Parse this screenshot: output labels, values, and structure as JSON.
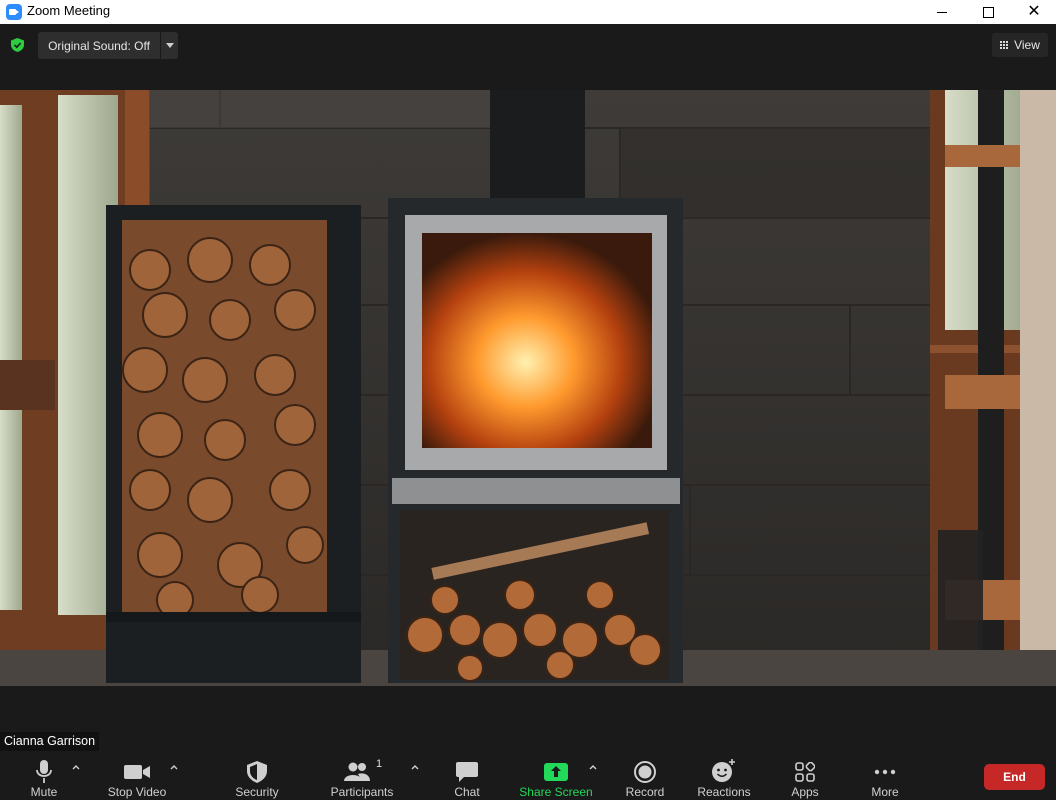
{
  "window": {
    "title": "Zoom Meeting"
  },
  "topbar": {
    "original_sound_label": "Original Sound: Off",
    "view_label": "View"
  },
  "video": {
    "participant_name": "Cianna Garrison"
  },
  "toolbar": {
    "mute": "Mute",
    "stop_video": "Stop Video",
    "security": "Security",
    "participants": "Participants",
    "participants_count": "1",
    "chat": "Chat",
    "share_screen": "Share Screen",
    "record": "Record",
    "reactions": "Reactions",
    "apps": "Apps",
    "more": "More",
    "end": "End"
  },
  "colors": {
    "share_green": "#23d959",
    "end_red": "#c62828",
    "shield_green": "#2ecc40",
    "app_blue": "#2d8cff"
  }
}
